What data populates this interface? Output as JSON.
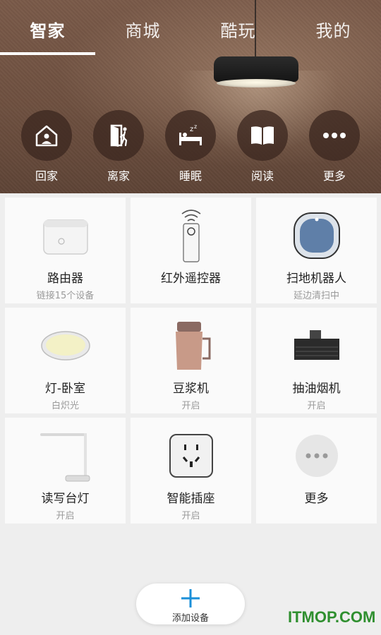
{
  "tabs": [
    {
      "label": "智家",
      "active": true
    },
    {
      "label": "商城",
      "active": false
    },
    {
      "label": "酷玩",
      "active": false
    },
    {
      "label": "我的",
      "active": false
    }
  ],
  "scenes": [
    {
      "label": "回家",
      "icon": "home-person-icon"
    },
    {
      "label": "离家",
      "icon": "leave-door-icon"
    },
    {
      "label": "睡眠",
      "icon": "bed-sleep-icon"
    },
    {
      "label": "阅读",
      "icon": "book-icon"
    },
    {
      "label": "更多",
      "icon": "more-dots-icon"
    }
  ],
  "devices": [
    {
      "name": "路由器",
      "status": "链接15个设备",
      "icon": "router-icon"
    },
    {
      "name": "红外遥控器",
      "status": "",
      "icon": "ir-remote-icon"
    },
    {
      "name": "扫地机器人",
      "status": "延边清扫中",
      "icon": "robot-vacuum-icon"
    },
    {
      "name": "灯-卧室",
      "status": "白炽光",
      "icon": "ceiling-lamp-icon"
    },
    {
      "name": "豆浆机",
      "status": "开启",
      "icon": "soymilk-maker-icon"
    },
    {
      "name": "抽油烟机",
      "status": "开启",
      "icon": "range-hood-icon"
    },
    {
      "name": "读写台灯",
      "status": "开启",
      "icon": "desk-lamp-icon"
    },
    {
      "name": "智能插座",
      "status": "开启",
      "icon": "smart-socket-icon"
    },
    {
      "name": "更多",
      "status": "",
      "icon": "more-dots-icon"
    }
  ],
  "add_device": {
    "label": "添加设备"
  },
  "watermark": "ITMOP.COM",
  "colors": {
    "accent": "#1a8fd8",
    "watermark": "#2f8f2f",
    "card_bg": "#fafafa"
  }
}
